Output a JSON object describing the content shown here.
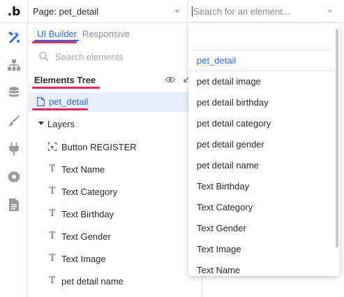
{
  "topbar": {
    "logo": ".b",
    "page_select": "Page: pet_detail",
    "search_placeholder": "Search for an element..."
  },
  "rail": {
    "icons": [
      "design-icon",
      "hierarchy-icon",
      "database-icon",
      "brush-icon",
      "plug-icon",
      "gear-icon",
      "document-icon"
    ]
  },
  "panel": {
    "tabs": [
      "UI Builder",
      "Responsive"
    ],
    "search_placeholder": "Search elements",
    "tree_header": "Elements Tree",
    "page_node": "pet_detail",
    "layers_label": "Layers",
    "items": [
      {
        "label": "Button REGISTER",
        "icon": "button-icon"
      },
      {
        "label": "Text Name",
        "icon": "text-icon"
      },
      {
        "label": "Text Category",
        "icon": "text-icon"
      },
      {
        "label": "Text Birthday",
        "icon": "text-icon"
      },
      {
        "label": "Text Gender",
        "icon": "text-icon"
      },
      {
        "label": "Text Image",
        "icon": "text-icon"
      },
      {
        "label": "pet detail name",
        "icon": "text-icon"
      }
    ]
  },
  "dropdown": {
    "items": [
      "pet_detail",
      "pet detail image",
      "pet detail birthday",
      "pet detail category",
      "pet detail gender",
      "pet detail name",
      "Text Birthday",
      "Text Category",
      "Text Gender",
      "Text Image",
      "Text Name"
    ],
    "selected": "pet_detail"
  },
  "colors": {
    "accent": "#2a6df0",
    "highlight": "#e8295b",
    "selected_row": "#e9f0fb"
  }
}
